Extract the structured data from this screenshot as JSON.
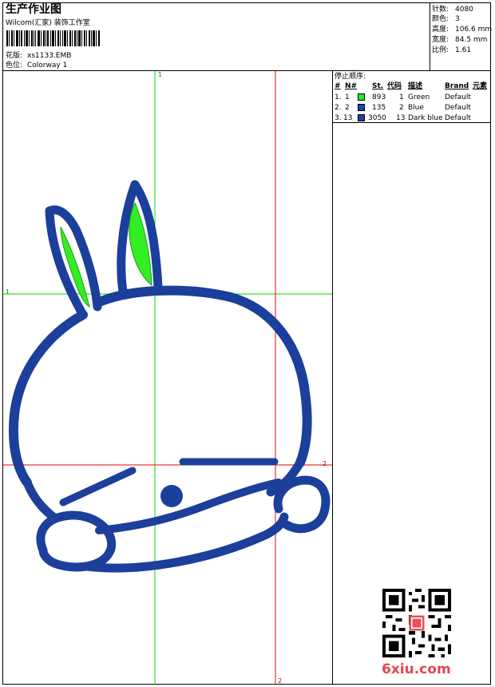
{
  "header": {
    "title": "生产作业图",
    "company": "Wilcom(汇家) 装饰工作室",
    "design_label": "花版:",
    "design_value": "xs1133.EMB",
    "colorway_label": "色位:",
    "colorway_value": "Colorway 1"
  },
  "stats": [
    {
      "label": "针数:",
      "value": "4080"
    },
    {
      "label": "颜色:",
      "value": "3"
    },
    {
      "label": "高度:",
      "value": "106.6 mm"
    },
    {
      "label": "宽度:",
      "value": "84.5 mm"
    },
    {
      "label": "比例:",
      "value": "1.61"
    }
  ],
  "stop_sequence": {
    "title": "停止顺序:",
    "columns": [
      "#",
      "N#",
      "St.",
      "代码",
      "描述",
      "Brand",
      "元素"
    ],
    "rows": [
      {
        "idx": "1.",
        "n": "1",
        "st": "893",
        "code": "1",
        "desc": "Green",
        "brand": "Default",
        "color": "#22ee22"
      },
      {
        "idx": "2.",
        "n": "2",
        "st": "135",
        "code": "2",
        "desc": "Blue",
        "brand": "Default",
        "color": "#1446b4"
      },
      {
        "idx": "3.",
        "n": "13",
        "st": "3050",
        "code": "13",
        "desc": "Dark blue",
        "brand": "Default",
        "color": "#1f3f9a"
      }
    ]
  },
  "guides": {
    "green_v_label": "1",
    "green_h_label": "1",
    "red_h_label": "2",
    "red_v_label": "2"
  },
  "colors": {
    "stitch_blue": "#1c3f9c",
    "leaf_green": "#33ee22",
    "guide_green": "#00dd00",
    "guide_red": "#ee0000",
    "watermark": "#e5464f"
  },
  "watermark": "6xiu.com"
}
